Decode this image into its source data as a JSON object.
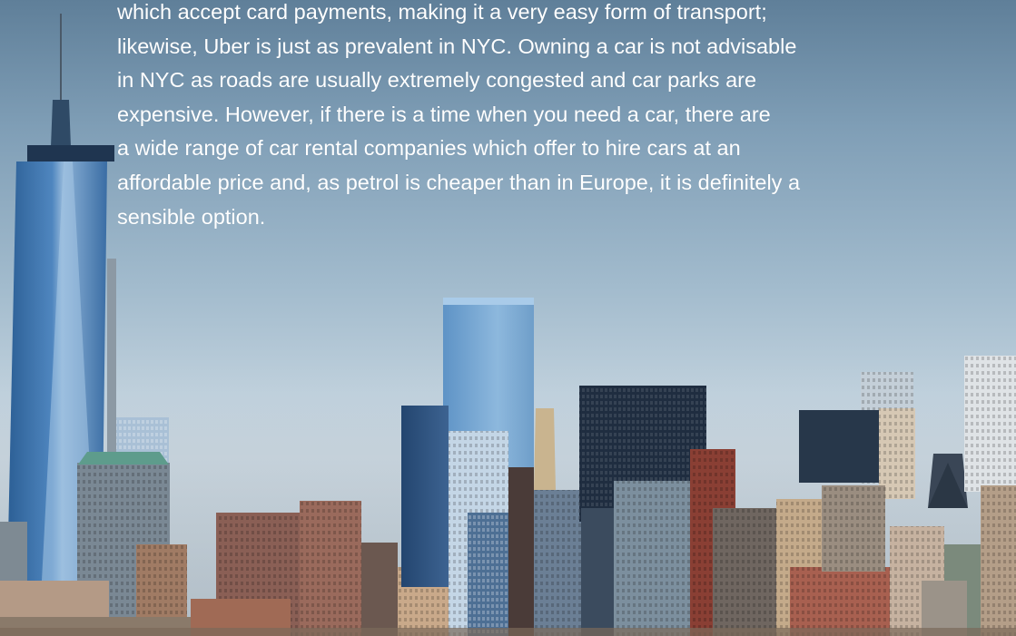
{
  "article": {
    "lines": [
      "which accept card payments, making it a very easy form of transport;",
      "likewise, Uber is just as prevalent in NYC. Owning a car is not advisable",
      "in NYC as roads are usually extremely congested and car parks are",
      "expensive. However, if there is a time when you need a car, there are",
      "a wide range of car rental companies which offer to hire cars at an",
      "affordable price and, as petrol is cheaper than in Europe, it is definitely a",
      "sensible option."
    ]
  },
  "colors": {
    "text": "#ffffff",
    "sky_top": "#5f7f99",
    "sky_bottom": "#c7d3dc"
  }
}
